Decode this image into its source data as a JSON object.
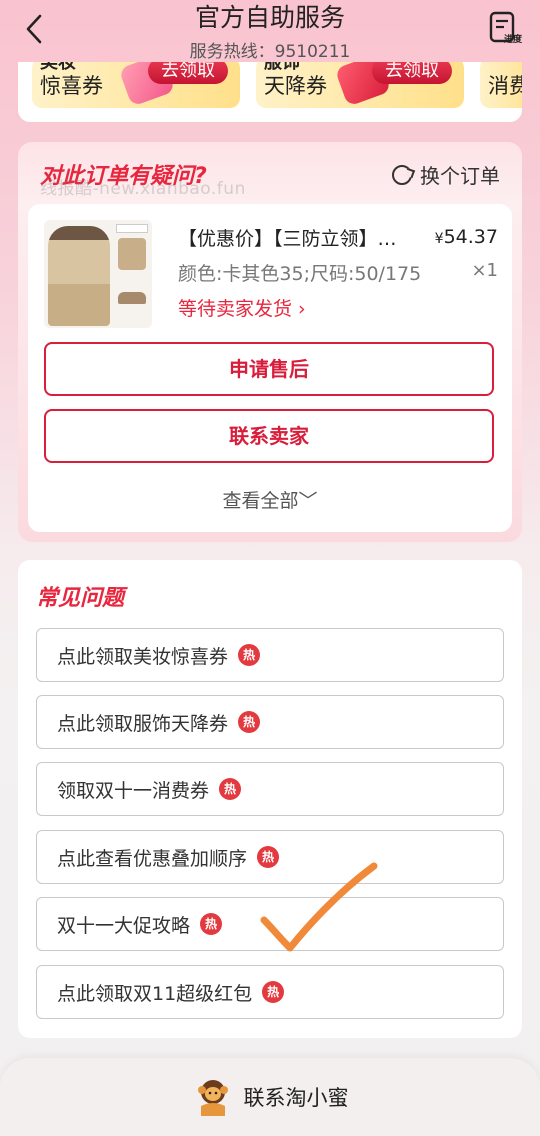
{
  "header": {
    "title": "官方自助服务",
    "hotline": "服务热线：9510211",
    "progress_label": "进度"
  },
  "coupons": [
    {
      "top": "美妆",
      "name": "惊喜券",
      "claim": "去领取"
    },
    {
      "top": "服饰",
      "name": "天降券",
      "claim": "去领取"
    },
    {
      "top": "",
      "name": "消费",
      "claim": ""
    }
  ],
  "order": {
    "section_title": "对此订单有疑问?",
    "watermark": "线报酷-new.xianbao.fun",
    "swap_label": "换个订单",
    "product_name": "【优惠价】【三防立领】…",
    "price_symbol": "¥",
    "price": "54.37",
    "spec": "颜色:卡其色35;尺码:50/175",
    "quantity": "×1",
    "status": "等待卖家发货 ›",
    "after_sale": "申请售后",
    "contact_seller": "联系卖家",
    "view_all": "查看全部﹀"
  },
  "faq": {
    "title": "常见问题",
    "hot_label": "热",
    "items": [
      "点此领取美妆惊喜券",
      "点此领取服饰天降券",
      "领取双十一消费券",
      "点此查看优惠叠加顺序",
      "双十一大促攻略",
      "点此领取双11超级红包"
    ]
  },
  "bottom": {
    "contact": "联系淘小蜜"
  },
  "colors": {
    "accent": "#e8273f",
    "button_border": "#d81e3b",
    "hot_badge": "#e23a3f",
    "annotation": "#f08a3a"
  }
}
